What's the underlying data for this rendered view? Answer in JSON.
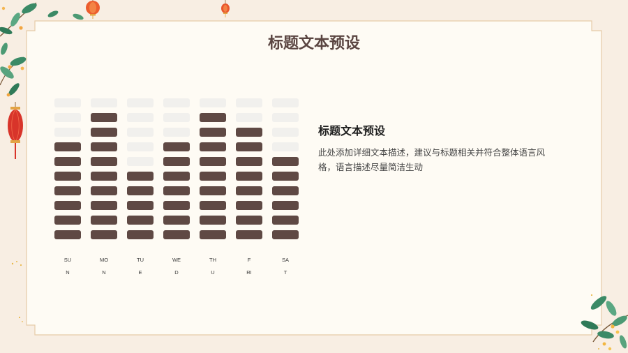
{
  "slide": {
    "title": "标题文本预设",
    "colors": {
      "background": "#f8eee3",
      "panel": "#fefbf4",
      "border": "#e6cba8",
      "title": "#5b4642",
      "unit_filled": "#5f4944",
      "unit_empty": "#f1f0ed"
    },
    "decorations": [
      "osmanthus-branch-icon",
      "red-lantern-icon",
      "gold-sparkle-icon"
    ]
  },
  "text_block": {
    "heading": "标题文本预设",
    "body": "此处添加详细文本描述，建议与标题相关并符合整体语言风格，语言描述尽量简洁生动"
  },
  "chart_data": {
    "type": "bar",
    "style": "stacked unit pictogram",
    "categories": [
      [
        "SU",
        "N"
      ],
      [
        "MO",
        "N"
      ],
      [
        "TU",
        "E"
      ],
      [
        "WE",
        "D"
      ],
      [
        "TH",
        "U"
      ],
      [
        "F",
        "RI"
      ],
      [
        "SA",
        "T"
      ]
    ],
    "values": [
      7,
      9,
      5,
      7,
      9,
      8,
      6
    ],
    "ylim": [
      0,
      10
    ],
    "grid": false,
    "legend": "none"
  }
}
